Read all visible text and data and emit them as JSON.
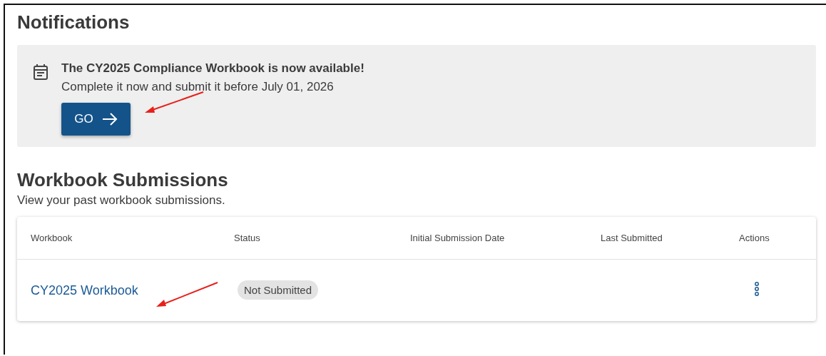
{
  "notifications": {
    "title": "Notifications",
    "items": [
      {
        "heading": "The CY2025 Compliance Workbook is now available!",
        "message": "Complete it now and submit it before July 01, 2026",
        "button": "GO"
      }
    ]
  },
  "submissions": {
    "title": "Workbook Submissions",
    "subtitle": "View your past workbook submissions.",
    "table": {
      "columns": [
        "Workbook",
        "Status",
        "Initial Submission Date",
        "Last Submitted",
        "Actions"
      ],
      "rows": [
        {
          "workbook": "CY2025 Workbook",
          "status": "Not Submitted",
          "initial_submission_date": "",
          "last_submitted": ""
        }
      ]
    }
  }
}
